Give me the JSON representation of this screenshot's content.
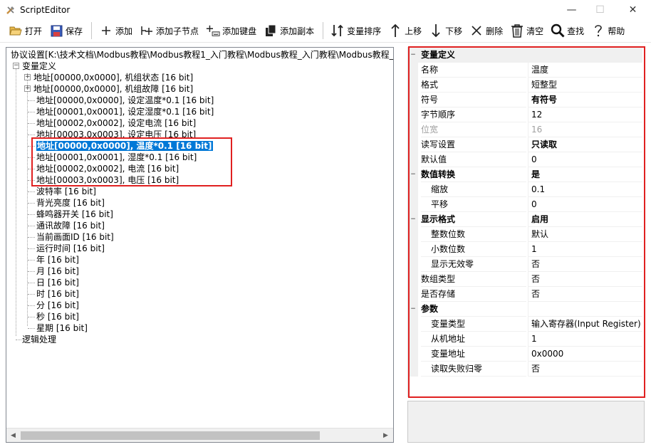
{
  "window": {
    "title": "ScriptEditor",
    "minimize": "—",
    "maximize": "☐",
    "close": "✕"
  },
  "toolbar": [
    {
      "icon": "open-folder-icon",
      "label": "打开"
    },
    {
      "icon": "save-disk-icon",
      "label": "保存"
    },
    {
      "icon": "plus-icon",
      "label": "添加"
    },
    {
      "icon": "add-child-node-icon",
      "label": "添加子节点"
    },
    {
      "icon": "add-keyboard-icon",
      "label": "添加键盘"
    },
    {
      "icon": "copy-icon",
      "label": "添加副本"
    },
    {
      "icon": "sort-icon",
      "label": "变量排序"
    },
    {
      "icon": "arrow-up-icon",
      "label": "上移"
    },
    {
      "icon": "arrow-down-icon",
      "label": "下移"
    },
    {
      "icon": "delete-x-icon",
      "label": "删除"
    },
    {
      "icon": "trash-icon",
      "label": "清空"
    },
    {
      "icon": "search-icon",
      "label": "查找"
    },
    {
      "icon": "help-icon",
      "label": "帮助"
    }
  ],
  "tree": {
    "root": "协议设置[K:\\技术文档\\Modbus教程\\Modbus教程1_入门教程\\Modbus教程_入门教程\\Modbus教程_入",
    "variables_node": "变量定义",
    "items": [
      {
        "text": "地址[00000,0x0000], 机组状态 [16 bit]",
        "expander": "+"
      },
      {
        "text": "地址[00000,0x0000], 机组故障 [16 bit]",
        "expander": "+"
      },
      {
        "text": "地址[00000,0x0000], 设定温度*0.1 [16 bit]",
        "expander": ""
      },
      {
        "text": "地址[00001,0x0001], 设定湿度*0.1 [16 bit]",
        "expander": ""
      },
      {
        "text": "地址[00002,0x0002], 设定电流 [16 bit]",
        "expander": ""
      },
      {
        "text": "地址[00003,0x0003], 设定电压 [16 bit]",
        "expander": ""
      },
      {
        "text": "地址[00000,0x0000], 温度*0.1 [16 bit]",
        "expander": "",
        "selected": true
      },
      {
        "text": "地址[00001,0x0001], 湿度*0.1 [16 bit]",
        "expander": ""
      },
      {
        "text": "地址[00002,0x0002], 电流 [16 bit]",
        "expander": ""
      },
      {
        "text": "地址[00003,0x0003], 电压 [16 bit]",
        "expander": ""
      },
      {
        "text": "波特率 [16 bit]",
        "expander": ""
      },
      {
        "text": "背光亮度 [16 bit]",
        "expander": ""
      },
      {
        "text": "蜂鸣器开关 [16 bit]",
        "expander": ""
      },
      {
        "text": "通讯故障 [16 bit]",
        "expander": ""
      },
      {
        "text": "当前画面ID [16 bit]",
        "expander": ""
      },
      {
        "text": "运行时间 [16 bit]",
        "expander": ""
      },
      {
        "text": "年 [16 bit]",
        "expander": ""
      },
      {
        "text": "月 [16 bit]",
        "expander": ""
      },
      {
        "text": "日 [16 bit]",
        "expander": ""
      },
      {
        "text": "时 [16 bit]",
        "expander": ""
      },
      {
        "text": "分 [16 bit]",
        "expander": ""
      },
      {
        "text": "秒 [16 bit]",
        "expander": ""
      },
      {
        "text": "星期 [16 bit]",
        "expander": ""
      }
    ],
    "logic_node": "逻辑处理",
    "expander_open": "−",
    "scroll_left": "◀",
    "scroll_right": "▶"
  },
  "properties": [
    {
      "kind": "cat",
      "name": "变量定义",
      "toggle": "−"
    },
    {
      "kind": "row",
      "name": "名称",
      "value": "温度"
    },
    {
      "kind": "row",
      "name": "格式",
      "value": "短整型"
    },
    {
      "kind": "row",
      "name": "符号",
      "value": "有符号",
      "bold": true
    },
    {
      "kind": "row",
      "name": "字节顺序",
      "value": "12"
    },
    {
      "kind": "row",
      "name": "位宽",
      "value": "16",
      "disabled": true
    },
    {
      "kind": "row",
      "name": "读写设置",
      "value": "只读取",
      "bold": true
    },
    {
      "kind": "row",
      "name": "默认值",
      "value": "0"
    },
    {
      "kind": "group",
      "name": "数值转换",
      "value": "是",
      "bold": true,
      "toggle": "−"
    },
    {
      "kind": "sub",
      "name": "缩放",
      "value": "0.1"
    },
    {
      "kind": "sub",
      "name": "平移",
      "value": "0"
    },
    {
      "kind": "group",
      "name": "显示格式",
      "value": "启用",
      "bold": true,
      "toggle": "−"
    },
    {
      "kind": "sub",
      "name": "整数位数",
      "value": "默认"
    },
    {
      "kind": "sub",
      "name": "小数位数",
      "value": "1"
    },
    {
      "kind": "sub",
      "name": "显示无效零",
      "value": "否"
    },
    {
      "kind": "row",
      "name": "数组类型",
      "value": "否"
    },
    {
      "kind": "row",
      "name": "是否存储",
      "value": "否"
    },
    {
      "kind": "group",
      "name": "参数",
      "value": "",
      "toggle": "−"
    },
    {
      "kind": "sub",
      "name": "变量类型",
      "value": "输入寄存器(Input Register)"
    },
    {
      "kind": "sub",
      "name": "从机地址",
      "value": "1"
    },
    {
      "kind": "sub",
      "name": "变量地址",
      "value": "0x0000"
    },
    {
      "kind": "sub",
      "name": "读取失败归零",
      "value": "否"
    }
  ],
  "colors": {
    "selection": "#0078d7",
    "highlight_border": "#e02020"
  }
}
